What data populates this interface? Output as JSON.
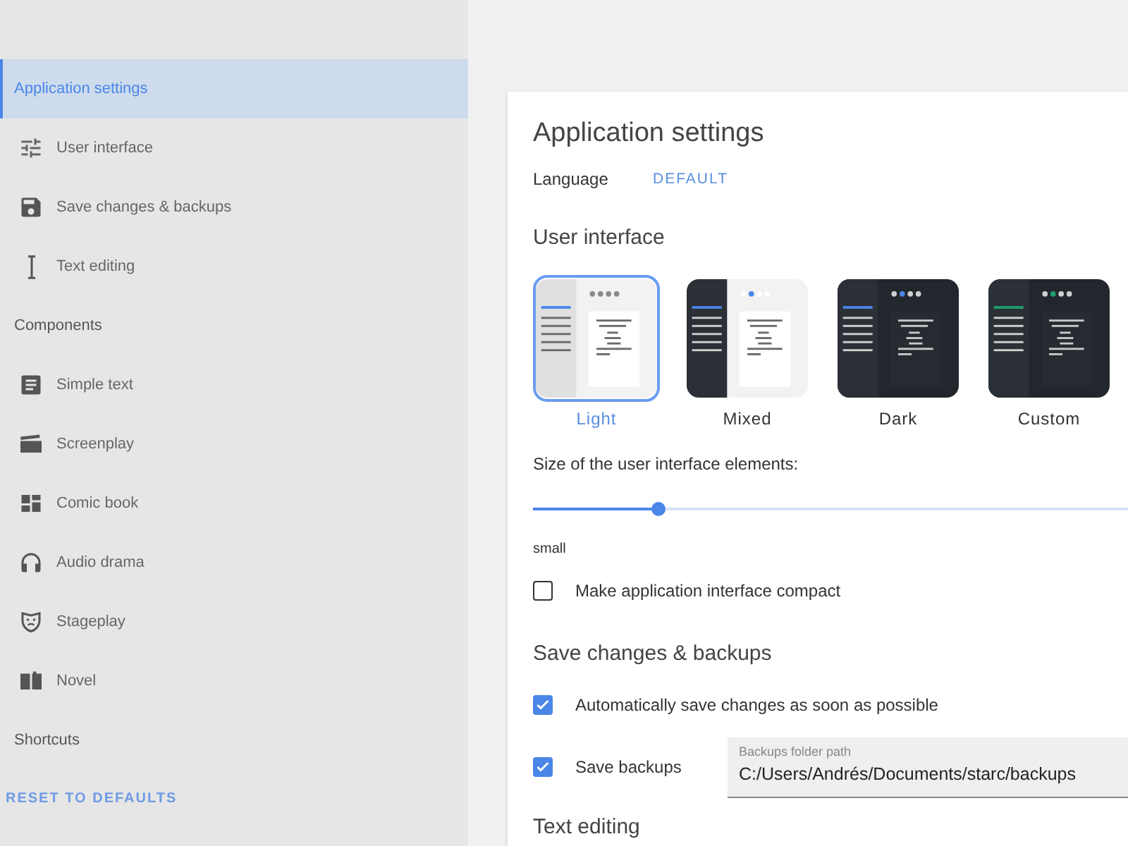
{
  "sidebar": {
    "items": [
      {
        "label": "Application settings",
        "selected": true,
        "children": [
          {
            "label": "User interface",
            "selected": false
          },
          {
            "label": "Save changes & backups",
            "selected": false
          },
          {
            "label": "Text editing",
            "selected": false
          }
        ]
      },
      {
        "label": "Components",
        "selected": false,
        "children": [
          {
            "label": "Simple text",
            "selected": false
          },
          {
            "label": "Screenplay",
            "selected": false
          },
          {
            "label": "Comic book",
            "selected": false
          },
          {
            "label": "Audio drama",
            "selected": false
          },
          {
            "label": "Stageplay",
            "selected": false
          },
          {
            "label": "Novel",
            "selected": false
          }
        ]
      },
      {
        "label": "Shortcuts",
        "selected": false
      }
    ],
    "reset_button": "RESET TO DEFAULTS"
  },
  "panel": {
    "title": "Application settings",
    "language": {
      "label": "Language",
      "value": "DEFAULT"
    },
    "user_interface": {
      "heading": "User interface",
      "themes": [
        {
          "label": "Light",
          "kind": "light",
          "color": "#4a86e8",
          "selected": true
        },
        {
          "label": "Mixed",
          "kind": "mixed",
          "color": "#4a86e8",
          "selected": false
        },
        {
          "label": "Dark",
          "kind": "dark",
          "color": "#4a86e8",
          "selected": false
        },
        {
          "label": "Custom",
          "kind": "dark",
          "color": "#1e9e6a",
          "selected": false
        }
      ],
      "size_label": "Size of the user interface elements:",
      "size_slider": {
        "level": 0.21
      },
      "size_value": "small",
      "compact": {
        "label": "Make application interface compact",
        "checked": false
      }
    },
    "save": {
      "heading": "Save changes & backups",
      "autosave": {
        "label": "Automatically save changes as soon as possible",
        "checked": true
      },
      "backups": {
        "label": "Save backups",
        "checked": true
      },
      "backups_path": {
        "label": "Backups folder path",
        "value": "C:/Users/Andrés/Documents/starc/backups"
      }
    },
    "text_editing": {
      "heading": "Text editing"
    }
  }
}
